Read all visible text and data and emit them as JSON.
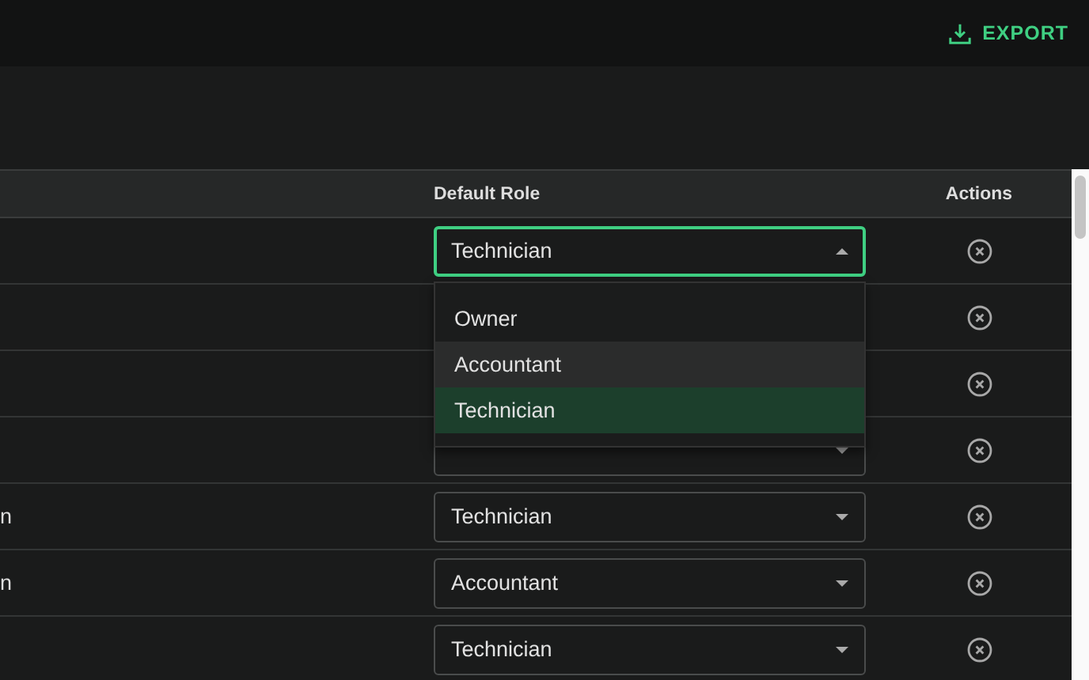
{
  "toolbar": {
    "export_button": "EXPORT"
  },
  "table": {
    "columns": [
      "Default Role",
      "Actions"
    ],
    "rows": [
      {
        "kind": "select",
        "role": "Technician",
        "menu": [
          {
            "label": "Owner",
            "selected": false,
            "highlighted": false
          },
          {
            "label": "Accountant",
            "selected": false,
            "highlighted": true
          },
          {
            "label": "Technician",
            "selected": true,
            "highlighted": false
          }
        ]
      },
      {
        "kind": "blank"
      },
      {
        "kind": "blank"
      },
      {
        "kind": "select"
      },
      {
        "kind": "select",
        "name": "n",
        "role": "Technician"
      },
      {
        "kind": "select",
        "name": "n",
        "role": "Accountant"
      },
      {
        "kind": "select",
        "role": "Technician"
      }
    ]
  }
}
